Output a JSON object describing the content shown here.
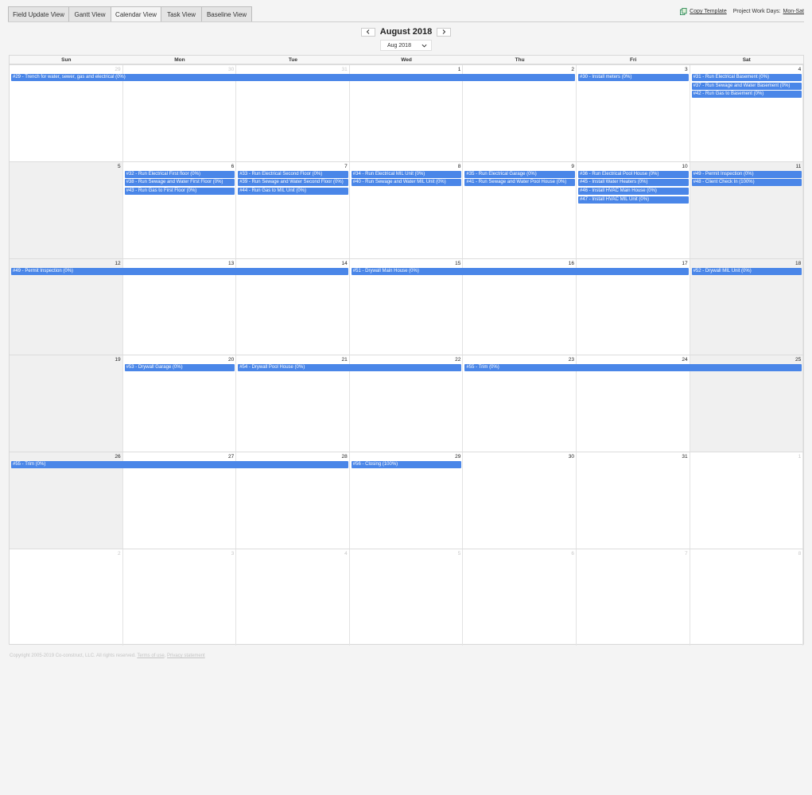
{
  "tabs": [
    {
      "label": "Field Update View",
      "active": false
    },
    {
      "label": "Gantt View",
      "active": false
    },
    {
      "label": "Calendar View",
      "active": true
    },
    {
      "label": "Task View",
      "active": false
    },
    {
      "label": "Baseline View",
      "active": false
    }
  ],
  "header": {
    "copy_template": "Copy Template",
    "work_days_label": "Project Work Days:",
    "work_days_value": "Mon-Sat"
  },
  "nav": {
    "month_title": "August 2018",
    "month_select": "Aug 2018"
  },
  "calendar": {
    "days_of_week": [
      "Sun",
      "Mon",
      "Tue",
      "Wed",
      "Thu",
      "Fri",
      "Sat"
    ],
    "weeks": [
      {
        "days": [
          {
            "num": "29",
            "muted": true
          },
          {
            "num": "30",
            "muted": true
          },
          {
            "num": "31",
            "muted": true
          },
          {
            "num": "1"
          },
          {
            "num": "2"
          },
          {
            "num": "3"
          },
          {
            "num": "4"
          }
        ],
        "events": [
          {
            "label": "#29 - Trench for water, sewer, gas and electrical (0%)",
            "start": 0,
            "span": 5,
            "row": 0
          },
          {
            "label": "#30 - Install meters (0%)",
            "start": 5,
            "span": 1,
            "row": 0
          },
          {
            "label": "#31 - Run Electrical Basement (0%)",
            "start": 6,
            "span": 1,
            "row": 0
          },
          {
            "label": "#37 - Run Sewage and Water Basement (0%)",
            "start": 6,
            "span": 1,
            "row": 1
          },
          {
            "label": "#42 - Run Gas to Basement (0%)",
            "start": 6,
            "span": 1,
            "row": 2
          }
        ]
      },
      {
        "days": [
          {
            "num": "5"
          },
          {
            "num": "6"
          },
          {
            "num": "7"
          },
          {
            "num": "8"
          },
          {
            "num": "9"
          },
          {
            "num": "10"
          },
          {
            "num": "11"
          }
        ],
        "events": [
          {
            "label": "#32 - Run Electrical First floor (0%)",
            "start": 1,
            "span": 1,
            "row": 0
          },
          {
            "label": "#38 - Run Sewage and Water First Floor (0%)",
            "start": 1,
            "span": 1,
            "row": 1
          },
          {
            "label": "#43 - Run Gas to First Floor (0%)",
            "start": 1,
            "span": 1,
            "row": 2
          },
          {
            "label": "#33 - Run Electrical Second Floor (0%)",
            "start": 2,
            "span": 1,
            "row": 0
          },
          {
            "label": "#39 - Run Sewage and Water Second Floor (0%)",
            "start": 2,
            "span": 1,
            "row": 1
          },
          {
            "label": "#44 - Run Gas to MIL Unit (0%)",
            "start": 2,
            "span": 1,
            "row": 2
          },
          {
            "label": "#34 - Run Electrical MIL Unit (0%)",
            "start": 3,
            "span": 1,
            "row": 0
          },
          {
            "label": "#40 - Run Sewage and Water MIL Unit (0%)",
            "start": 3,
            "span": 1,
            "row": 1
          },
          {
            "label": "#35 - Run Electrical Garage (0%)",
            "start": 4,
            "span": 1,
            "row": 0
          },
          {
            "label": "#41 - Run Sewage and Water Pool House (0%)",
            "start": 4,
            "span": 1,
            "row": 1
          },
          {
            "label": "#36 - Run Electrical Pool House (0%)",
            "start": 5,
            "span": 1,
            "row": 0
          },
          {
            "label": "#45 - Install Water Heaters (0%)",
            "start": 5,
            "span": 1,
            "row": 1
          },
          {
            "label": "#46 - Install HVAC Main House (0%)",
            "start": 5,
            "span": 1,
            "row": 2
          },
          {
            "label": "#47 - Install HVAC MIL Unit (0%)",
            "start": 5,
            "span": 1,
            "row": 3
          },
          {
            "label": "#49 - Permit Inspection (0%)",
            "start": 6,
            "span": 1,
            "row": 0
          },
          {
            "label": "#48 - Client Check In (100%)",
            "start": 6,
            "span": 1,
            "row": 1
          }
        ]
      },
      {
        "days": [
          {
            "num": "12"
          },
          {
            "num": "13"
          },
          {
            "num": "14"
          },
          {
            "num": "15"
          },
          {
            "num": "16"
          },
          {
            "num": "17"
          },
          {
            "num": "18"
          }
        ],
        "events": [
          {
            "label": "#49 - Permit Inspection (0%)",
            "start": 0,
            "span": 3,
            "row": 0
          },
          {
            "label": "#51 - Drywall Main House (0%)",
            "start": 3,
            "span": 3,
            "row": 0
          },
          {
            "label": "#52 - Drywall MIL Unit (0%)",
            "start": 6,
            "span": 1,
            "row": 0
          }
        ]
      },
      {
        "days": [
          {
            "num": "19"
          },
          {
            "num": "20"
          },
          {
            "num": "21"
          },
          {
            "num": "22"
          },
          {
            "num": "23"
          },
          {
            "num": "24"
          },
          {
            "num": "25"
          }
        ],
        "events": [
          {
            "label": "#53 - Drywall Garage (0%)",
            "start": 1,
            "span": 1,
            "row": 0
          },
          {
            "label": "#54 - Drywall Pool House (0%)",
            "start": 2,
            "span": 2,
            "row": 0
          },
          {
            "label": "#55 - Trim (0%)",
            "start": 4,
            "span": 3,
            "row": 0
          }
        ]
      },
      {
        "days": [
          {
            "num": "26"
          },
          {
            "num": "27"
          },
          {
            "num": "28"
          },
          {
            "num": "29"
          },
          {
            "num": "30"
          },
          {
            "num": "31"
          },
          {
            "num": "1",
            "muted": true
          }
        ],
        "events": [
          {
            "label": "#55 - Trim (0%)",
            "start": 0,
            "span": 3,
            "row": 0
          },
          {
            "label": "#56 - Closing (100%)",
            "start": 3,
            "span": 1,
            "row": 0
          }
        ]
      },
      {
        "days": [
          {
            "num": "2",
            "muted": true
          },
          {
            "num": "3",
            "muted": true
          },
          {
            "num": "4",
            "muted": true
          },
          {
            "num": "5",
            "muted": true
          },
          {
            "num": "6",
            "muted": true
          },
          {
            "num": "7",
            "muted": true
          },
          {
            "num": "8",
            "muted": true
          }
        ],
        "events": []
      }
    ]
  },
  "footer": {
    "copyright": "Copyright 2005-2019 Co-construct, LLC. All rights reserved.",
    "terms": "Terms of use",
    "separator": ",",
    "privacy": "Privacy statement"
  },
  "colors": {
    "event": "#4a86e8"
  }
}
